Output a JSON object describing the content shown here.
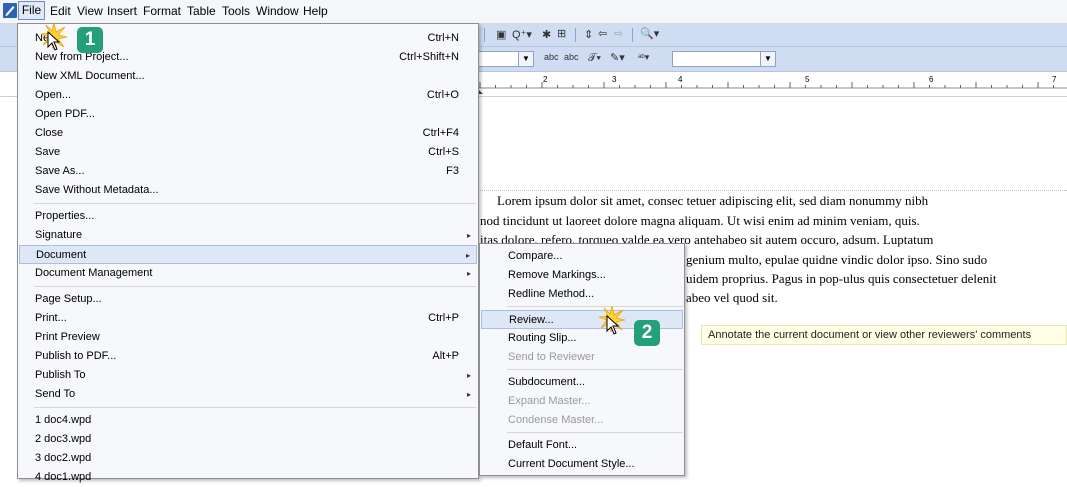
{
  "menubar": {
    "items": [
      "File",
      "Edit",
      "View",
      "Insert",
      "Format",
      "Table",
      "Tools",
      "Window",
      "Help"
    ]
  },
  "file_menu": {
    "items": [
      {
        "label": "New",
        "shortcut": "Ctrl+N"
      },
      {
        "label": "New from Project...",
        "shortcut": "Ctrl+Shift+N"
      },
      {
        "label": "New XML Document...",
        "shortcut": ""
      },
      {
        "label": "Open...",
        "shortcut": "Ctrl+O"
      },
      {
        "label": "Open PDF...",
        "shortcut": ""
      },
      {
        "label": "Close",
        "shortcut": "Ctrl+F4"
      },
      {
        "label": "Save",
        "shortcut": "Ctrl+S"
      },
      {
        "label": "Save As...",
        "shortcut": "F3"
      },
      {
        "label": "Save Without Metadata...",
        "shortcut": ""
      },
      {
        "label": "Properties...",
        "shortcut": ""
      },
      {
        "label": "Signature",
        "shortcut": ""
      },
      {
        "label": "Document",
        "shortcut": ""
      },
      {
        "label": "Document Management",
        "shortcut": ""
      },
      {
        "label": "Page Setup...",
        "shortcut": ""
      },
      {
        "label": "Print...",
        "shortcut": "Ctrl+P"
      },
      {
        "label": "Print Preview",
        "shortcut": ""
      },
      {
        "label": "Publish to PDF...",
        "shortcut": "Alt+P"
      },
      {
        "label": "Publish To",
        "shortcut": ""
      },
      {
        "label": "Send To",
        "shortcut": ""
      },
      {
        "label": "1 doc4.wpd",
        "shortcut": ""
      },
      {
        "label": "2 doc3.wpd",
        "shortcut": ""
      },
      {
        "label": "3 doc2.wpd",
        "shortcut": ""
      },
      {
        "label": "4 doc1.wpd",
        "shortcut": ""
      }
    ]
  },
  "document_submenu": {
    "items": [
      {
        "label": "Compare...",
        "enabled": true
      },
      {
        "label": "Remove Markings...",
        "enabled": true
      },
      {
        "label": "Redline Method...",
        "enabled": true
      },
      {
        "label": "Review...",
        "enabled": true
      },
      {
        "label": "Routing Slip...",
        "enabled": true
      },
      {
        "label": "Send to Reviewer",
        "enabled": false
      },
      {
        "label": "Subdocument...",
        "enabled": true
      },
      {
        "label": "Expand Master...",
        "enabled": false
      },
      {
        "label": "Condense Master...",
        "enabled": false
      },
      {
        "label": "Default Font...",
        "enabled": true
      },
      {
        "label": "Current Document Style...",
        "enabled": true
      }
    ]
  },
  "tooltip": "Annotate the current document or view other reviewers' comments",
  "document_text": {
    "line1": "Lorem ipsum dolor sit amet, consec tetuer adipiscing elit, sed diam nonummy nibh",
    "line2": "nod tincidunt ut laoreet dolore magna aliquam. Ut wisi enim ad minim veniam, quis.",
    "line3": "itas dolore, refero, torqueo valde ea vero antehabeo sit autem occuro, adsum. Luptatum",
    "line4": "genium multo, epulae quidne vindic dolor ipso. Sino sudo",
    "line5": "uidem proprius. Pagus in pop-ulus quis consectetuer delenit",
    "line6": "abeo vel quod sit."
  },
  "ruler": {
    "numbers": [
      "2",
      "3",
      "4",
      "5",
      "6",
      "7"
    ]
  },
  "callouts": {
    "step1": "1",
    "step2": "2"
  },
  "colors": {
    "badge": "#23a07b",
    "highlight": "#dde7f5",
    "toolbar": "#cfdcf1"
  }
}
